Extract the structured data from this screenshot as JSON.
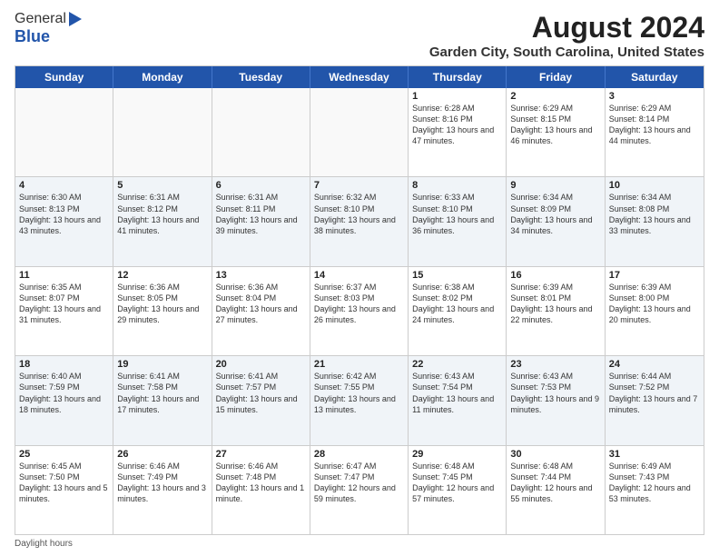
{
  "logo": {
    "general": "General",
    "blue": "Blue"
  },
  "title": "August 2024",
  "subtitle": "Garden City, South Carolina, United States",
  "days": [
    "Sunday",
    "Monday",
    "Tuesday",
    "Wednesday",
    "Thursday",
    "Friday",
    "Saturday"
  ],
  "weeks": [
    [
      {
        "day": "",
        "text": ""
      },
      {
        "day": "",
        "text": ""
      },
      {
        "day": "",
        "text": ""
      },
      {
        "day": "",
        "text": ""
      },
      {
        "day": "1",
        "text": "Sunrise: 6:28 AM\nSunset: 8:16 PM\nDaylight: 13 hours and 47 minutes."
      },
      {
        "day": "2",
        "text": "Sunrise: 6:29 AM\nSunset: 8:15 PM\nDaylight: 13 hours and 46 minutes."
      },
      {
        "day": "3",
        "text": "Sunrise: 6:29 AM\nSunset: 8:14 PM\nDaylight: 13 hours and 44 minutes."
      }
    ],
    [
      {
        "day": "4",
        "text": "Sunrise: 6:30 AM\nSunset: 8:13 PM\nDaylight: 13 hours and 43 minutes."
      },
      {
        "day": "5",
        "text": "Sunrise: 6:31 AM\nSunset: 8:12 PM\nDaylight: 13 hours and 41 minutes."
      },
      {
        "day": "6",
        "text": "Sunrise: 6:31 AM\nSunset: 8:11 PM\nDaylight: 13 hours and 39 minutes."
      },
      {
        "day": "7",
        "text": "Sunrise: 6:32 AM\nSunset: 8:10 PM\nDaylight: 13 hours and 38 minutes."
      },
      {
        "day": "8",
        "text": "Sunrise: 6:33 AM\nSunset: 8:10 PM\nDaylight: 13 hours and 36 minutes."
      },
      {
        "day": "9",
        "text": "Sunrise: 6:34 AM\nSunset: 8:09 PM\nDaylight: 13 hours and 34 minutes."
      },
      {
        "day": "10",
        "text": "Sunrise: 6:34 AM\nSunset: 8:08 PM\nDaylight: 13 hours and 33 minutes."
      }
    ],
    [
      {
        "day": "11",
        "text": "Sunrise: 6:35 AM\nSunset: 8:07 PM\nDaylight: 13 hours and 31 minutes."
      },
      {
        "day": "12",
        "text": "Sunrise: 6:36 AM\nSunset: 8:05 PM\nDaylight: 13 hours and 29 minutes."
      },
      {
        "day": "13",
        "text": "Sunrise: 6:36 AM\nSunset: 8:04 PM\nDaylight: 13 hours and 27 minutes."
      },
      {
        "day": "14",
        "text": "Sunrise: 6:37 AM\nSunset: 8:03 PM\nDaylight: 13 hours and 26 minutes."
      },
      {
        "day": "15",
        "text": "Sunrise: 6:38 AM\nSunset: 8:02 PM\nDaylight: 13 hours and 24 minutes."
      },
      {
        "day": "16",
        "text": "Sunrise: 6:39 AM\nSunset: 8:01 PM\nDaylight: 13 hours and 22 minutes."
      },
      {
        "day": "17",
        "text": "Sunrise: 6:39 AM\nSunset: 8:00 PM\nDaylight: 13 hours and 20 minutes."
      }
    ],
    [
      {
        "day": "18",
        "text": "Sunrise: 6:40 AM\nSunset: 7:59 PM\nDaylight: 13 hours and 18 minutes."
      },
      {
        "day": "19",
        "text": "Sunrise: 6:41 AM\nSunset: 7:58 PM\nDaylight: 13 hours and 17 minutes."
      },
      {
        "day": "20",
        "text": "Sunrise: 6:41 AM\nSunset: 7:57 PM\nDaylight: 13 hours and 15 minutes."
      },
      {
        "day": "21",
        "text": "Sunrise: 6:42 AM\nSunset: 7:55 PM\nDaylight: 13 hours and 13 minutes."
      },
      {
        "day": "22",
        "text": "Sunrise: 6:43 AM\nSunset: 7:54 PM\nDaylight: 13 hours and 11 minutes."
      },
      {
        "day": "23",
        "text": "Sunrise: 6:43 AM\nSunset: 7:53 PM\nDaylight: 13 hours and 9 minutes."
      },
      {
        "day": "24",
        "text": "Sunrise: 6:44 AM\nSunset: 7:52 PM\nDaylight: 13 hours and 7 minutes."
      }
    ],
    [
      {
        "day": "25",
        "text": "Sunrise: 6:45 AM\nSunset: 7:50 PM\nDaylight: 13 hours and 5 minutes."
      },
      {
        "day": "26",
        "text": "Sunrise: 6:46 AM\nSunset: 7:49 PM\nDaylight: 13 hours and 3 minutes."
      },
      {
        "day": "27",
        "text": "Sunrise: 6:46 AM\nSunset: 7:48 PM\nDaylight: 13 hours and 1 minute."
      },
      {
        "day": "28",
        "text": "Sunrise: 6:47 AM\nSunset: 7:47 PM\nDaylight: 12 hours and 59 minutes."
      },
      {
        "day": "29",
        "text": "Sunrise: 6:48 AM\nSunset: 7:45 PM\nDaylight: 12 hours and 57 minutes."
      },
      {
        "day": "30",
        "text": "Sunrise: 6:48 AM\nSunset: 7:44 PM\nDaylight: 12 hours and 55 minutes."
      },
      {
        "day": "31",
        "text": "Sunrise: 6:49 AM\nSunset: 7:43 PM\nDaylight: 12 hours and 53 minutes."
      }
    ]
  ],
  "footer": "Daylight hours"
}
